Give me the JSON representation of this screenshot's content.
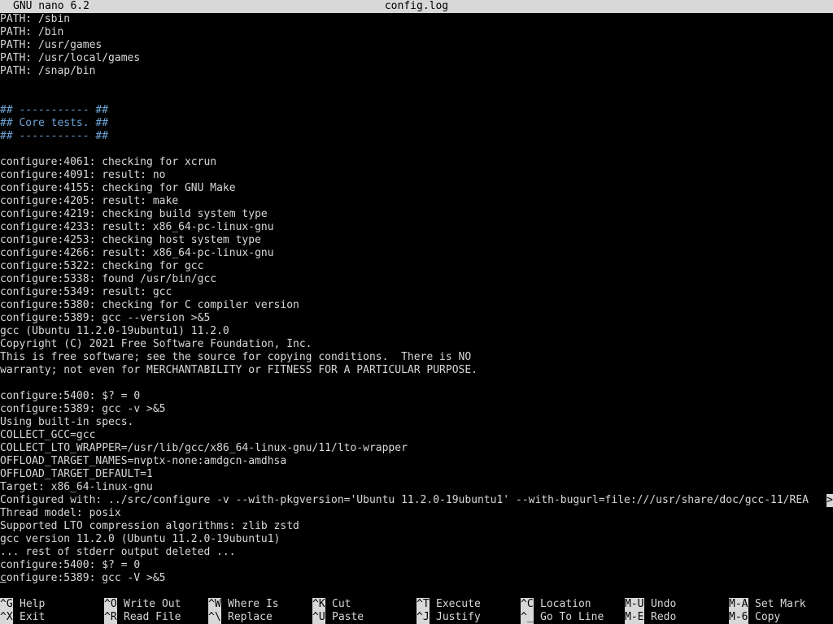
{
  "titlebar": {
    "app": "GNU nano 6.2",
    "filename": "config.log"
  },
  "lines": [
    {
      "text": "PATH: /sbin",
      "kind": "normal"
    },
    {
      "text": "PATH: /bin",
      "kind": "normal"
    },
    {
      "text": "PATH: /usr/games",
      "kind": "normal"
    },
    {
      "text": "PATH: /usr/local/games",
      "kind": "normal"
    },
    {
      "text": "PATH: /snap/bin",
      "kind": "normal"
    },
    {
      "text": "",
      "kind": "normal"
    },
    {
      "text": "",
      "kind": "normal"
    },
    {
      "text": "## ----------- ##",
      "kind": "comment"
    },
    {
      "text": "## Core tests. ##",
      "kind": "comment"
    },
    {
      "text": "## ----------- ##",
      "kind": "comment"
    },
    {
      "text": "",
      "kind": "normal"
    },
    {
      "text": "configure:4061: checking for xcrun",
      "kind": "normal"
    },
    {
      "text": "configure:4091: result: no",
      "kind": "normal"
    },
    {
      "text": "configure:4155: checking for GNU Make",
      "kind": "normal"
    },
    {
      "text": "configure:4205: result: make",
      "kind": "normal"
    },
    {
      "text": "configure:4219: checking build system type",
      "kind": "normal"
    },
    {
      "text": "configure:4233: result: x86_64-pc-linux-gnu",
      "kind": "normal"
    },
    {
      "text": "configure:4253: checking host system type",
      "kind": "normal"
    },
    {
      "text": "configure:4266: result: x86_64-pc-linux-gnu",
      "kind": "normal"
    },
    {
      "text": "configure:5322: checking for gcc",
      "kind": "normal"
    },
    {
      "text": "configure:5338: found /usr/bin/gcc",
      "kind": "normal"
    },
    {
      "text": "configure:5349: result: gcc",
      "kind": "normal"
    },
    {
      "text": "configure:5380: checking for C compiler version",
      "kind": "normal"
    },
    {
      "text": "configure:5389: gcc --version >&5",
      "kind": "normal"
    },
    {
      "text": "gcc (Ubuntu 11.2.0-19ubuntu1) 11.2.0",
      "kind": "normal"
    },
    {
      "text": "Copyright (C) 2021 Free Software Foundation, Inc.",
      "kind": "normal"
    },
    {
      "text": "This is free software; see the source for copying conditions.  There is NO",
      "kind": "normal"
    },
    {
      "text": "warranty; not even for MERCHANTABILITY or FITNESS FOR A PARTICULAR PURPOSE.",
      "kind": "normal"
    },
    {
      "text": "",
      "kind": "normal"
    },
    {
      "text": "configure:5400: $? = 0",
      "kind": "normal"
    },
    {
      "text": "configure:5389: gcc -v >&5",
      "kind": "normal"
    },
    {
      "text": "Using built-in specs.",
      "kind": "normal"
    },
    {
      "text": "COLLECT_GCC=gcc",
      "kind": "normal"
    },
    {
      "text": "COLLECT_LTO_WRAPPER=/usr/lib/gcc/x86_64-linux-gnu/11/lto-wrapper",
      "kind": "normal"
    },
    {
      "text": "OFFLOAD_TARGET_NAMES=nvptx-none:amdgcn-amdhsa",
      "kind": "normal"
    },
    {
      "text": "OFFLOAD_TARGET_DEFAULT=1",
      "kind": "normal"
    },
    {
      "text": "Target: x86_64-linux-gnu",
      "kind": "normal"
    },
    {
      "text": "Configured with: ../src/configure -v --with-pkgversion='Ubuntu 11.2.0-19ubuntu1' --with-bugurl=file:///usr/share/doc/gcc-11/REA",
      "kind": "overflow"
    },
    {
      "text": "Thread model: posix",
      "kind": "normal"
    },
    {
      "text": "Supported LTO compression algorithms: zlib zstd",
      "kind": "normal"
    },
    {
      "text": "gcc version 11.2.0 (Ubuntu 11.2.0-19ubuntu1)",
      "kind": "normal"
    },
    {
      "text": "... rest of stderr output deleted ...",
      "kind": "normal"
    },
    {
      "text": "configure:5400: $? = 0",
      "kind": "normal"
    },
    {
      "text": "configure:5389: gcc -V >&5",
      "kind": "cursor"
    }
  ],
  "overflow_marker": ">",
  "shortcuts": [
    {
      "key": "^G",
      "label": "Help",
      "name": "help"
    },
    {
      "key": "^X",
      "label": "Exit",
      "name": "exit"
    },
    {
      "key": "^O",
      "label": "Write Out",
      "name": "write-out"
    },
    {
      "key": "^R",
      "label": "Read File",
      "name": "read-file"
    },
    {
      "key": "^W",
      "label": "Where Is",
      "name": "where-is"
    },
    {
      "key": "^\\",
      "label": "Replace",
      "name": "replace"
    },
    {
      "key": "^K",
      "label": "Cut",
      "name": "cut"
    },
    {
      "key": "^U",
      "label": "Paste",
      "name": "paste"
    },
    {
      "key": "^T",
      "label": "Execute",
      "name": "execute"
    },
    {
      "key": "^J",
      "label": "Justify",
      "name": "justify"
    },
    {
      "key": "^C",
      "label": "Location",
      "name": "location"
    },
    {
      "key": "^_",
      "label": "Go To Line",
      "name": "go-to-line"
    },
    {
      "key": "M-U",
      "label": "Undo",
      "name": "undo"
    },
    {
      "key": "M-E",
      "label": "Redo",
      "name": "redo"
    },
    {
      "key": "M-A",
      "label": "Set Mark",
      "name": "set-mark"
    },
    {
      "key": "M-6",
      "label": "Copy",
      "name": "copy"
    }
  ],
  "colors": {
    "background": "#000000",
    "text": "#d8d8d8",
    "comment": "#6ea5d8",
    "bar": "#d8d8d8"
  }
}
